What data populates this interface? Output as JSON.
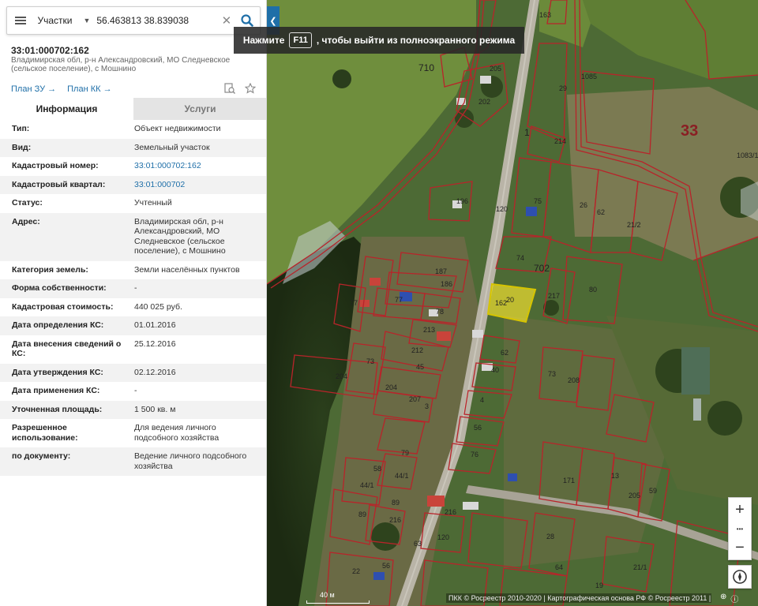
{
  "search": {
    "type_label": "Участки",
    "value": "56.463813 38.839038",
    "clear_glyph": "✕"
  },
  "banner": {
    "prefix": "Нажмите",
    "key": "F11",
    "suffix": ", чтобы выйти из полноэкранного режима"
  },
  "object": {
    "number": "33:01:000702:162",
    "address": "Владимирская обл, р-н Александровский, МО Следневское (сельское поселение), с Мошнино"
  },
  "links": {
    "plan_zu": "План ЗУ →",
    "plan_kk": "План КК →"
  },
  "tabs": {
    "info": "Информация",
    "services": "Услуги"
  },
  "properties": [
    {
      "key": "Тип:",
      "value": "Объект недвижимости"
    },
    {
      "key": "Вид:",
      "value": "Земельный участок"
    },
    {
      "key": "Кадастровый номер:",
      "value": "33:01:000702:162",
      "link": true
    },
    {
      "key": "Кадастровый квартал:",
      "value": "33:01:000702",
      "link": true
    },
    {
      "key": "Статус:",
      "value": "Учтенный"
    },
    {
      "key": "Адрес:",
      "value": "Владимирская обл, р-н Александровский, МО Следневское (сельское поселение), с Мошнино"
    },
    {
      "key": "Категория земель:",
      "value": "Земли населённых пунктов"
    },
    {
      "key": "Форма собственности:",
      "value": "-"
    },
    {
      "key": "Кадастровая стоимость:",
      "value": "440 025 руб."
    },
    {
      "key": "Дата определения КС:",
      "value": "01.01.2016"
    },
    {
      "key": "Дата внесения сведений о КС:",
      "value": "25.12.2016"
    },
    {
      "key": "Дата утверждения КС:",
      "value": "02.12.2016"
    },
    {
      "key": "Дата применения КС:",
      "value": "-"
    },
    {
      "key": "Уточненная площадь:",
      "value": "1 500 кв. м"
    },
    {
      "key": "Разрешенное использование:",
      "value": "Для ведения личного подсобного хозяйства"
    },
    {
      "key": "по документу:",
      "value": "Ведение личного подсобного хозяйства"
    }
  ],
  "map": {
    "parcel_labels": [
      "163",
      "205",
      "202",
      "710",
      "1",
      "29",
      "1085",
      "33",
      "214",
      "1083/1",
      "75",
      "196",
      "120",
      "26",
      "62",
      "21/2",
      "702",
      "74",
      "187",
      "186",
      "80",
      "217",
      "162",
      "20",
      "77",
      "77",
      "78",
      "213",
      "212",
      "62",
      "73",
      "45",
      "204",
      "204",
      "73",
      "208",
      "207",
      "40",
      "4",
      "3",
      "56",
      "76",
      "79",
      "58",
      "44/1",
      "44/1",
      "89",
      "89",
      "216",
      "216",
      "171",
      "13",
      "205",
      "59",
      "63",
      "120",
      "28",
      "64",
      "21/1",
      "19",
      "22",
      "56",
      "91"
    ],
    "scale": "40 м",
    "attribution": "ПКК © Росреестр 2010-2020 | Картографическая основа РФ © Росреестр 2011 | Map",
    "colors": {
      "parcel_border": "#b8242a",
      "selected_fill": "#f0e030",
      "accent": "#1f6fa8"
    }
  },
  "controls": {
    "zoom_in": "+",
    "more": "•••",
    "zoom_out": "−"
  }
}
